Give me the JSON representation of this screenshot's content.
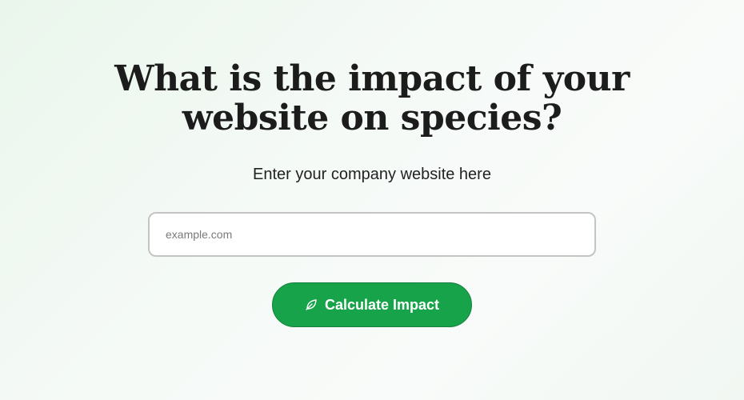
{
  "hero": {
    "title_line1": "What is the impact of your",
    "title_line2": "website on species?",
    "subtitle": "Enter your company website here"
  },
  "form": {
    "website_input": {
      "value": "",
      "placeholder": "example.com"
    },
    "submit": {
      "label": "Calculate Impact",
      "icon": "leaf-icon"
    }
  },
  "colors": {
    "accent": "#17a34a",
    "title": "#1c1c1c",
    "input_border": "#c4c4c4"
  }
}
